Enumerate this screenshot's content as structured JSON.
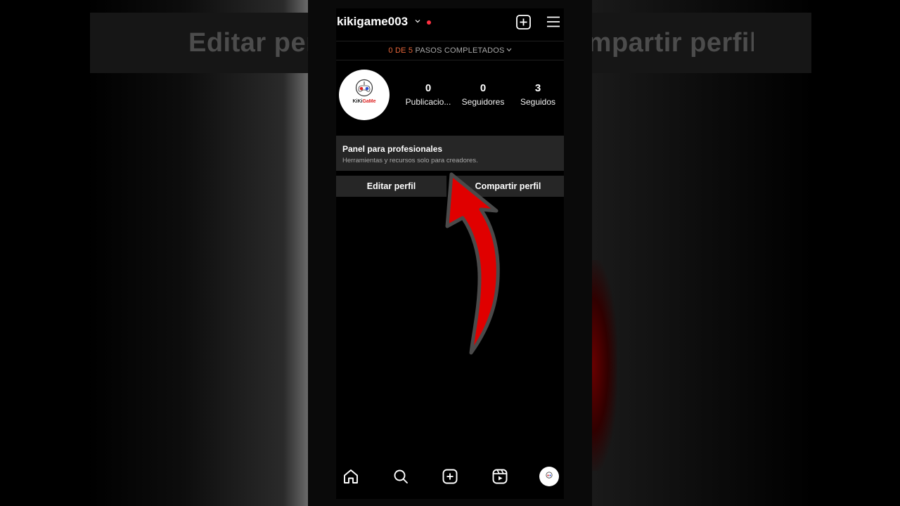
{
  "background": {
    "left_text": "Editar perfil",
    "right_text": "Compartir perfil"
  },
  "header": {
    "username": "kikigame003",
    "notification_color": "#ff3040",
    "icons": [
      "chevron-down-icon",
      "add-post-icon",
      "menu-icon"
    ]
  },
  "steps": {
    "count": "0 DE 5",
    "label": "PASOS COMPLETADOS",
    "count_color": "#e8673a"
  },
  "profile": {
    "avatar_text_a": "KiKi",
    "avatar_text_b": "GaMe",
    "stats": [
      {
        "value": "0",
        "label": "Publicacio..."
      },
      {
        "value": "0",
        "label": "Seguidores"
      },
      {
        "value": "3",
        "label": "Seguidos"
      }
    ]
  },
  "pro_panel": {
    "title": "Panel para profesionales",
    "subtitle": "Herramientas y recursos solo para creadores."
  },
  "buttons": {
    "edit": "Editar perfil",
    "share": "Compartir perfil"
  },
  "annotation": {
    "arrow_color": "#e00000"
  },
  "bottom_nav": [
    "home-icon",
    "search-icon",
    "create-icon",
    "reels-icon",
    "profile-avatar"
  ]
}
